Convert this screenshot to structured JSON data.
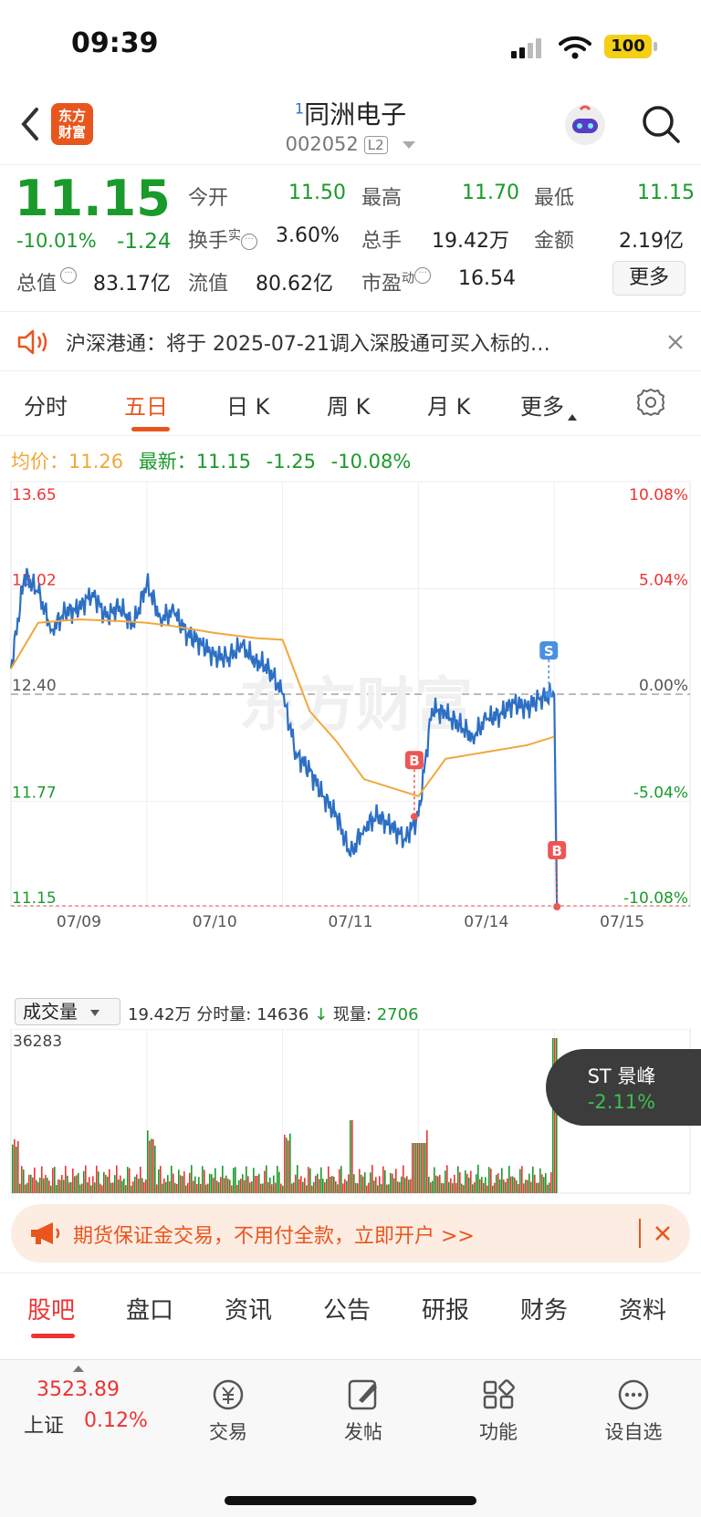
{
  "status_bar": {
    "time": "09:39",
    "battery": "100"
  },
  "header": {
    "logo_text_1": "东方",
    "logo_text_2": "财富",
    "superscript": "1",
    "stock_name": "同洲电子",
    "stock_code": "002052",
    "level_badge": "L2"
  },
  "quote": {
    "price": "11.15",
    "change_pct": "-10.01%",
    "change": "-1.24",
    "fields": [
      {
        "label": "今开",
        "value": "11.50"
      },
      {
        "label": "最高",
        "value": "11.70"
      },
      {
        "label": "最低",
        "value": "11.15"
      },
      {
        "label": "换手",
        "sup": "实",
        "value": "3.60%"
      },
      {
        "label": "总手",
        "value": "19.42万"
      },
      {
        "label": "金额",
        "value": "2.19亿"
      },
      {
        "label": "总值",
        "value": "83.17亿"
      },
      {
        "label": "流值",
        "value": "80.62亿"
      },
      {
        "label": "市盈",
        "sup": "动",
        "value": "16.54"
      }
    ],
    "more_button": "更多"
  },
  "notice": {
    "text": "沪深港通：将于 2025-07-21调入深股通可买入标的…"
  },
  "chart_tabs": [
    "分时",
    "五日",
    "日 K",
    "周 K",
    "月 K",
    "更多"
  ],
  "active_tab": "五日",
  "legend": {
    "avg_label": "均价：",
    "avg_value": "11.26",
    "latest_label": "最新：",
    "latest_value": "11.15",
    "latest_change": "-1.25",
    "latest_pct": "-10.08%"
  },
  "watermark": "东方财富",
  "chart_data": {
    "type": "line",
    "title": "",
    "x_dates": [
      "07/09",
      "07/10",
      "07/11",
      "07/14",
      "07/15"
    ],
    "y_ticks_left": [
      "13.65",
      "13.02",
      "12.40",
      "11.77",
      "11.15"
    ],
    "y_ticks_right": [
      "10.08%",
      "5.04%",
      "0.00%",
      "-5.04%",
      "-10.08%"
    ],
    "ylim": [
      11.15,
      13.65
    ],
    "prev_close": 12.4,
    "series": [
      {
        "name": "",
        "color": "#2d6fc4",
        "x": [
          0,
          0.1,
          0.2,
          0.3,
          0.4,
          0.5,
          0.6,
          0.7,
          0.8,
          0.9,
          1.0,
          1.1,
          1.2,
          1.3,
          1.4,
          1.5,
          1.6,
          1.7,
          1.8,
          1.9,
          2.0,
          2.1,
          2.2,
          2.3,
          2.4,
          2.5,
          2.6,
          2.7,
          2.8,
          2.9,
          3.0,
          3.1,
          3.2,
          3.3,
          3.4,
          3.5,
          3.6,
          3.7,
          3.8,
          3.9,
          4.0,
          4.02
        ],
        "y": [
          12.55,
          13.1,
          13.0,
          12.78,
          12.88,
          12.9,
          13.0,
          12.85,
          12.92,
          12.8,
          13.05,
          12.85,
          12.88,
          12.75,
          12.7,
          12.62,
          12.62,
          12.68,
          12.6,
          12.55,
          12.4,
          12.05,
          11.95,
          11.8,
          11.68,
          11.45,
          11.62,
          11.68,
          11.62,
          11.55,
          11.68,
          12.32,
          12.28,
          12.22,
          12.15,
          12.25,
          12.28,
          12.35,
          12.32,
          12.38,
          12.4,
          11.15
        ]
      },
      {
        "name": "",
        "color": "#f0a83a",
        "x": [
          0,
          0.2,
          0.5,
          0.8,
          1.0,
          1.2,
          1.5,
          1.8,
          2.0,
          2.2,
          2.4,
          2.6,
          2.8,
          3.0,
          3.2,
          3.5,
          3.8,
          4.0
        ],
        "y": [
          12.55,
          12.82,
          12.84,
          12.83,
          12.82,
          12.8,
          12.76,
          12.73,
          12.72,
          12.3,
          12.12,
          11.9,
          11.85,
          11.8,
          12.02,
          12.06,
          12.1,
          12.15
        ]
      }
    ],
    "markers": [
      {
        "label": "B",
        "color": "#e55",
        "x": 2.97,
        "y": 11.68
      },
      {
        "label": "S",
        "color": "#4a90e2",
        "x": 3.96,
        "y": 12.4
      },
      {
        "label": "B",
        "color": "#e55",
        "x": 4.02,
        "y": 11.15
      }
    ],
    "volume": {
      "label": "成交量",
      "summary_total": "19.42万",
      "summary_minute_label": "分时量:",
      "summary_minute": "14636",
      "summary_now_label": "现量:",
      "summary_now": "2706",
      "max_label": "36283"
    }
  },
  "float_tag": {
    "name": "ST 景峰",
    "pct": "-2.11%"
  },
  "banner": {
    "text": "期货保证金交易，不用付全款，立即开户 >>"
  },
  "bottom_tabs": [
    "股吧",
    "盘口",
    "资讯",
    "公告",
    "研报",
    "财务",
    "资料"
  ],
  "active_bottom_tab": "股吧",
  "bottom_nav": {
    "index_value": "3523.89",
    "index_name": "上证",
    "index_pct": "0.12%",
    "items": [
      "交易",
      "发帖",
      "功能",
      "设自选"
    ]
  }
}
